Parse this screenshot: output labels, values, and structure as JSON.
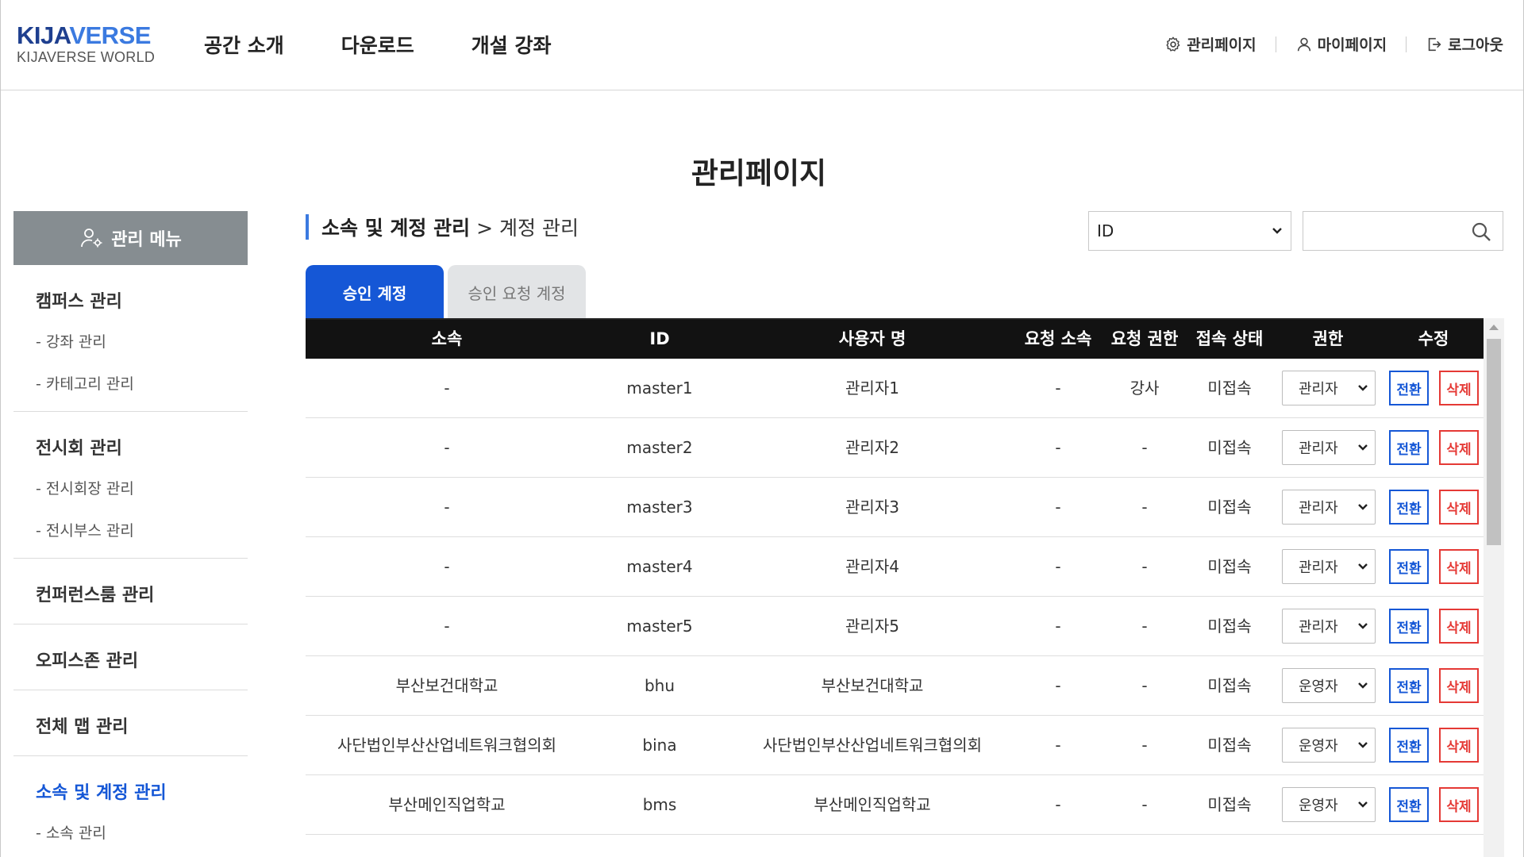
{
  "header": {
    "logo_main_a": "KIJA",
    "logo_main_b": "VERSE",
    "logo_sub": "KIJAVERSE WORLD",
    "nav": [
      "공간 소개",
      "다운로드",
      "개설 강좌"
    ],
    "util": {
      "admin": "관리페이지",
      "mypage": "마이페이지",
      "logout": "로그아웃"
    }
  },
  "page_title": "관리페이지",
  "sidebar": {
    "title": "관리 메뉴",
    "sections": [
      {
        "title": "캠퍼스 관리",
        "items": [
          "- 강좌 관리",
          "- 카테고리 관리"
        ]
      },
      {
        "title": "전시회 관리",
        "items": [
          "- 전시회장 관리",
          "- 전시부스 관리"
        ]
      },
      {
        "title": "컨퍼런스룸 관리",
        "items": []
      },
      {
        "title": "오피스존 관리",
        "items": []
      },
      {
        "title": "전체 맵 관리",
        "items": []
      },
      {
        "title": "소속 및 계정 관리",
        "items": [
          "- 소속 관리"
        ]
      }
    ]
  },
  "breadcrumb": {
    "section": "소속 및 계정 관리",
    "page": "> 계정 관리"
  },
  "search": {
    "field_value": "ID",
    "placeholder": ""
  },
  "tabs": {
    "approved": "승인 계정",
    "pending": "승인 요청 계정"
  },
  "table": {
    "headers": [
      "소속",
      "ID",
      "사용자 명",
      "요청 소속",
      "요청 권한",
      "접속 상태",
      "권한",
      "수정"
    ],
    "switch_label": "전환",
    "delete_label": "삭제",
    "rows": [
      {
        "org": "-",
        "id": "master1",
        "name": "관리자1",
        "req_org": "-",
        "req_role": "강사",
        "status": "미접속",
        "role": "관리자"
      },
      {
        "org": "-",
        "id": "master2",
        "name": "관리자2",
        "req_org": "-",
        "req_role": "-",
        "status": "미접속",
        "role": "관리자"
      },
      {
        "org": "-",
        "id": "master3",
        "name": "관리자3",
        "req_org": "-",
        "req_role": "-",
        "status": "미접속",
        "role": "관리자"
      },
      {
        "org": "-",
        "id": "master4",
        "name": "관리자4",
        "req_org": "-",
        "req_role": "-",
        "status": "미접속",
        "role": "관리자"
      },
      {
        "org": "-",
        "id": "master5",
        "name": "관리자5",
        "req_org": "-",
        "req_role": "-",
        "status": "미접속",
        "role": "관리자"
      },
      {
        "org": "부산보건대학교",
        "id": "bhu",
        "name": "부산보건대학교",
        "req_org": "-",
        "req_role": "-",
        "status": "미접속",
        "role": "운영자"
      },
      {
        "org": "사단법인부산산업네트워크협의회",
        "id": "bina",
        "name": "사단법인부산산업네트워크협의회",
        "req_org": "-",
        "req_role": "-",
        "status": "미접속",
        "role": "운영자"
      },
      {
        "org": "부산메인직업학교",
        "id": "bms",
        "name": "부산메인직업학교",
        "req_org": "-",
        "req_role": "-",
        "status": "미접속",
        "role": "운영자"
      }
    ]
  },
  "colors": {
    "accent": "#1557d6",
    "danger": "#e53935",
    "table_header": "#121212",
    "sidebar_head": "#868d91"
  }
}
